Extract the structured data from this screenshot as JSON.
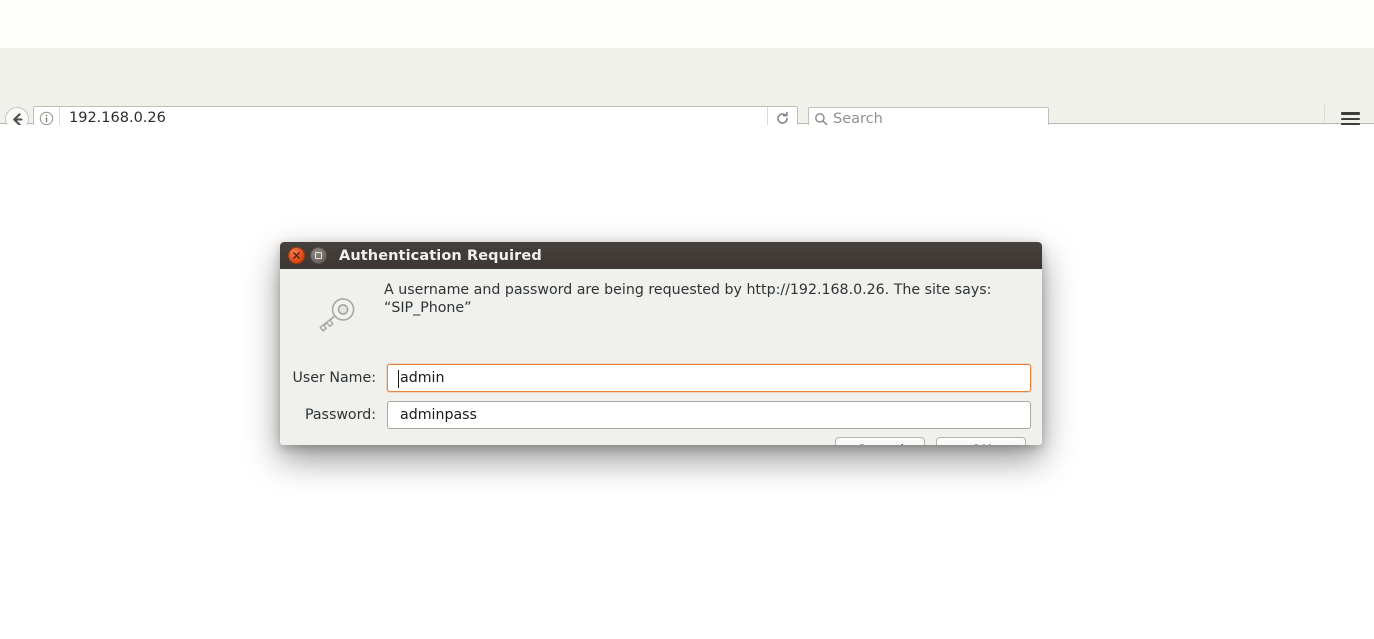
{
  "browser": {
    "toolbar": {
      "back_icon": "back-arrow-icon",
      "identity_icon": "site-info-icon",
      "url": "192.168.0.26",
      "reload_icon": "reload-icon",
      "menu_icon": "hamburger-menu-icon"
    },
    "search": {
      "icon": "search-icon",
      "placeholder": "Search",
      "value": ""
    }
  },
  "dialog": {
    "title": "Authentication Required",
    "close_icon": "close-icon",
    "maximize_icon": "maximize-icon",
    "key_icon": "key-icon",
    "message": "A username and password are being requested by http://192.168.0.26. The site says: “SIP_Phone”",
    "fields": [
      {
        "label": "User Name:",
        "value": "admin",
        "placeholder": "",
        "focused": true
      },
      {
        "label": "Password:",
        "value": "adminpass",
        "placeholder": "",
        "focused": false
      }
    ],
    "buttons": {
      "cancel": "Cancel",
      "ok": "OK"
    }
  },
  "colors": {
    "titlebar_bg": "#3c3733",
    "close_button": "#dd4814",
    "dialog_bg": "#f0f0ed",
    "toolbar_bg": "#f1f1ec",
    "focus_border": "#e8833a"
  }
}
